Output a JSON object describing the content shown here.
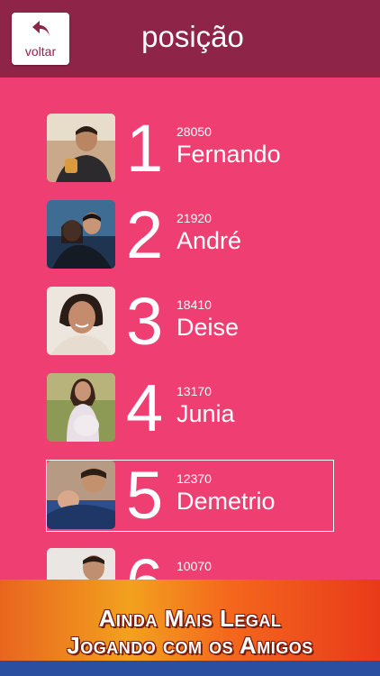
{
  "header": {
    "back_label": "voltar",
    "title": "posição",
    "background": "#8e2448"
  },
  "ranking": [
    {
      "rank": "1",
      "score": "28050",
      "name": "Fernando",
      "highlighted": false
    },
    {
      "rank": "2",
      "score": "21920",
      "name": "André",
      "highlighted": false
    },
    {
      "rank": "3",
      "score": "18410",
      "name": "Deise",
      "highlighted": false
    },
    {
      "rank": "4",
      "score": "13170",
      "name": "Junia",
      "highlighted": false
    },
    {
      "rank": "5",
      "score": "12370",
      "name": "Demetrio",
      "highlighted": true
    },
    {
      "rank": "6",
      "score": "10070",
      "name": "",
      "highlighted": false
    }
  ],
  "promo": {
    "line1": "Ainda Mais Legal",
    "line2": "Jogando com os Amigos"
  },
  "colors": {
    "background": "#ef3e72",
    "header": "#8e2448",
    "text": "#ffffff",
    "banner_orange": "#f4671d",
    "banner_blue": "#2a4fa0"
  }
}
